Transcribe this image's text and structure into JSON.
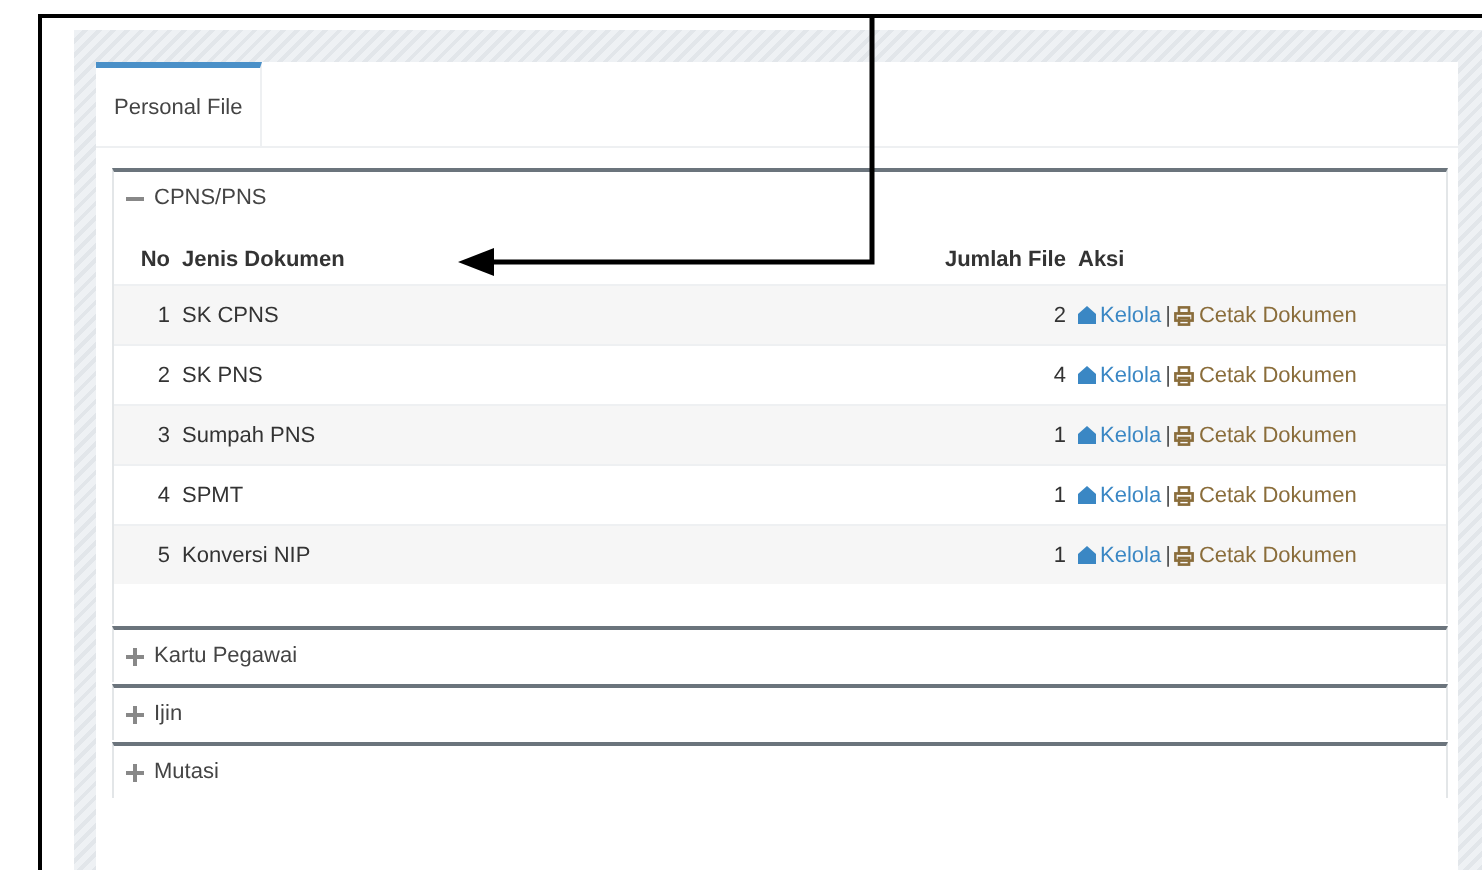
{
  "tabs": [
    {
      "label": "Personal File",
      "selected": true
    }
  ],
  "sections": [
    {
      "title": "CPNS/PNS",
      "expanded": true,
      "columns": [
        "No",
        "Jenis Dokumen",
        "Jumlah File",
        "Aksi"
      ],
      "rows": [
        {
          "no": "1",
          "name": "SK CPNS",
          "count": "2",
          "manage": "Kelola",
          "separator": "|",
          "print": "Cetak Dokumen"
        },
        {
          "no": "2",
          "name": "SK PNS",
          "count": "4",
          "manage": "Kelola",
          "separator": "|",
          "print": "Cetak Dokumen"
        },
        {
          "no": "3",
          "name": "Sumpah PNS",
          "count": "1",
          "manage": "Kelola",
          "separator": "|",
          "print": "Cetak Dokumen"
        },
        {
          "no": "4",
          "name": "SPMT",
          "count": "1",
          "manage": "Kelola",
          "separator": "|",
          "print": "Cetak Dokumen"
        },
        {
          "no": "5",
          "name": "Konversi NIP",
          "count": "1",
          "manage": "Kelola",
          "separator": "|",
          "print": "Cetak Dokumen"
        }
      ]
    },
    {
      "title": "Kartu Pegawai",
      "expanded": false
    },
    {
      "title": "Ijin",
      "expanded": false
    },
    {
      "title": "Mutasi",
      "expanded": false
    }
  ]
}
